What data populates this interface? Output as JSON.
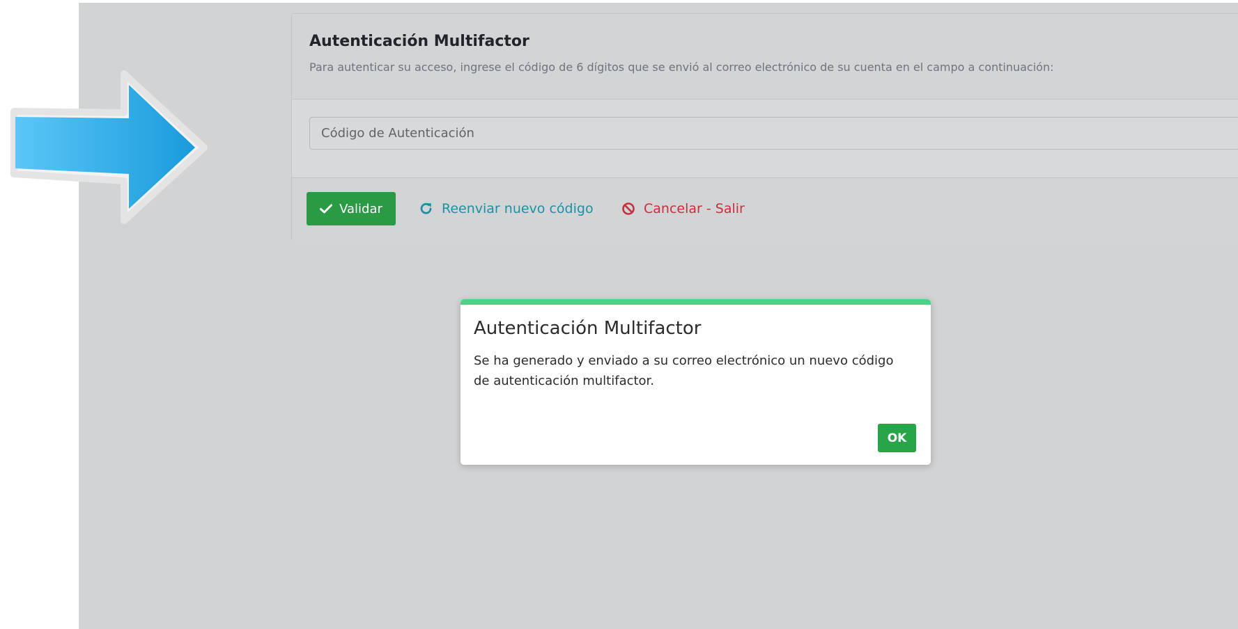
{
  "card": {
    "title": "Autenticación Multifactor",
    "subtitle": "Para autenticar su acceso, ingrese el código de 6 dígitos que se envió al correo electrónico de su cuenta en el campo a continuación:",
    "code_input": {
      "placeholder": "Código de Autenticación",
      "value": ""
    },
    "buttons": {
      "validar": "Validar",
      "reenviar": "Reenviar nuevo código",
      "cancelar": "Cancelar - Salir"
    }
  },
  "dialog": {
    "title": "Autenticación Multifactor",
    "message": "Se ha generado y enviado a su correo electrónico un nuevo código de autenticación multifactor.",
    "ok_label": "OK"
  },
  "icons": {
    "validar": "check-icon",
    "reenviar": "redo-icon",
    "cancelar": "ban-icon",
    "annotation": "arrow-right-icon"
  },
  "colors": {
    "success": "#2a9a45",
    "info_link": "#1f8fa3",
    "danger_link": "#c4303c",
    "dialog_accent": "#49d384",
    "arrow": "#2aa9ec"
  }
}
